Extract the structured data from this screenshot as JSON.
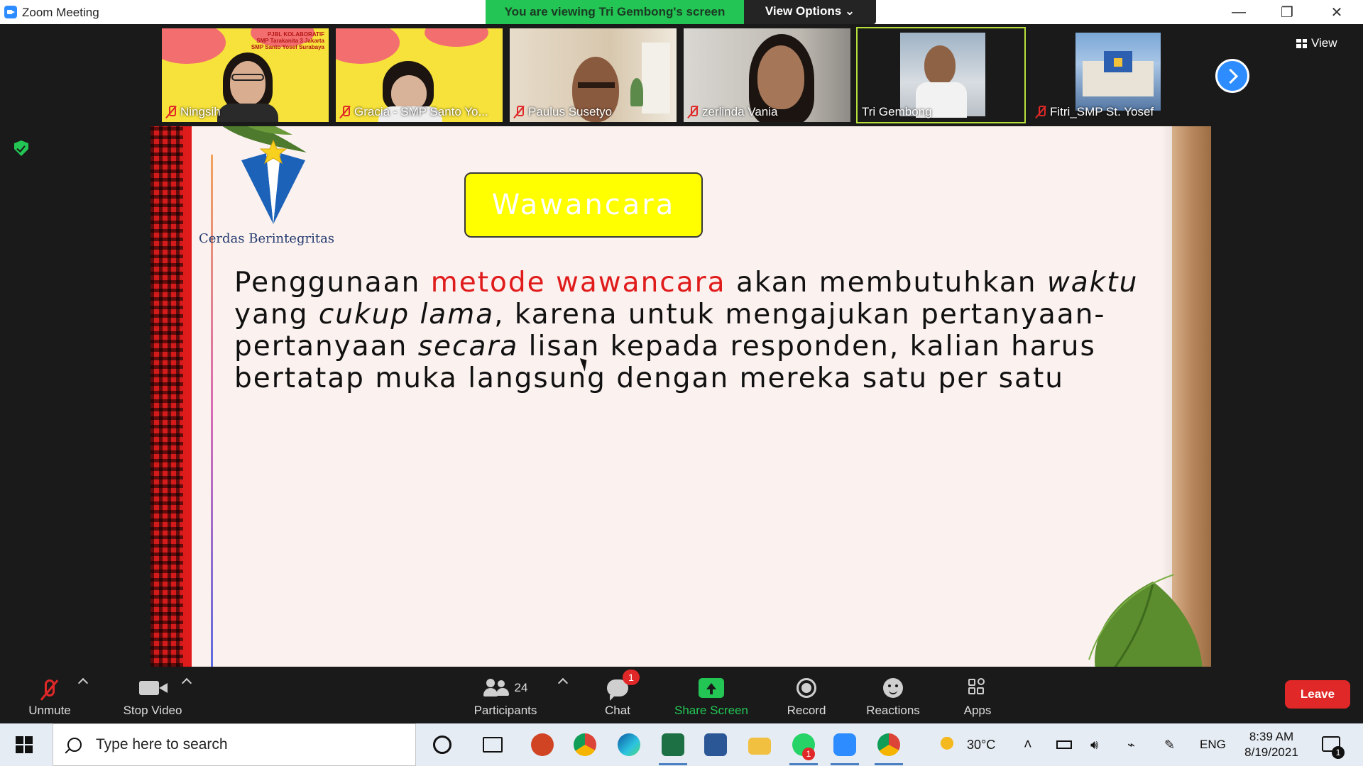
{
  "window": {
    "title": "Zoom Meeting",
    "viewing_banner": "You are viewing Tri Gembong's screen",
    "view_options": "View Options ⌄"
  },
  "participants_strip": [
    {
      "name": "Ningsih",
      "muted": true
    },
    {
      "name": "Gracia - SMP Santo Yo...",
      "muted": true
    },
    {
      "name": "Paulus Susetyo",
      "muted": true
    },
    {
      "name": "zerlinda Vania",
      "muted": true
    },
    {
      "name": "Tri Gembong",
      "muted": false,
      "active": true
    },
    {
      "name": "Fitri_SMP St. Yosef",
      "muted": true
    }
  ],
  "poster_text": "PJBL KOLABORATIF\nSMP Tarakanita 3 Jakarta\nSMP Santo Yosef Surabaya",
  "view_button": "View",
  "slide": {
    "logo_caption": "Cerdas Berintegritas",
    "title": "Wawancara",
    "body": {
      "p1": "Penggunaan ",
      "highlight": "metode wawancara",
      "p2": " akan membutuhkan ",
      "italic1": "waktu",
      "p3": " yang ",
      "italic2": "cukup lama",
      "p4": ", karena untuk mengajukan pertanyaan-pertanyaan ",
      "italic3": "secara",
      "p5": " lisan kepada responden, kalian harus bertatap muka langsung dengan mereka satu per satu"
    }
  },
  "toolbar": {
    "unmute": "Unmute",
    "stop_video": "Stop Video",
    "participants": "Participants",
    "participants_count": "24",
    "chat": "Chat",
    "chat_badge": "1",
    "share_screen": "Share Screen",
    "record": "Record",
    "reactions": "Reactions",
    "apps": "Apps",
    "leave": "Leave"
  },
  "taskbar": {
    "search_placeholder": "Type here to search",
    "weather": "30°C",
    "language": "ENG",
    "time": "8:39 AM",
    "date": "8/19/2021",
    "whatsapp_badge": "1",
    "notification_badge": "1"
  },
  "colors": {
    "zoom_blue": "#2d8cff",
    "share_green": "#23c554",
    "leave_red": "#e02828",
    "slide_title_yellow": "#ffff00",
    "slide_highlight_red": "#e01b1b"
  }
}
